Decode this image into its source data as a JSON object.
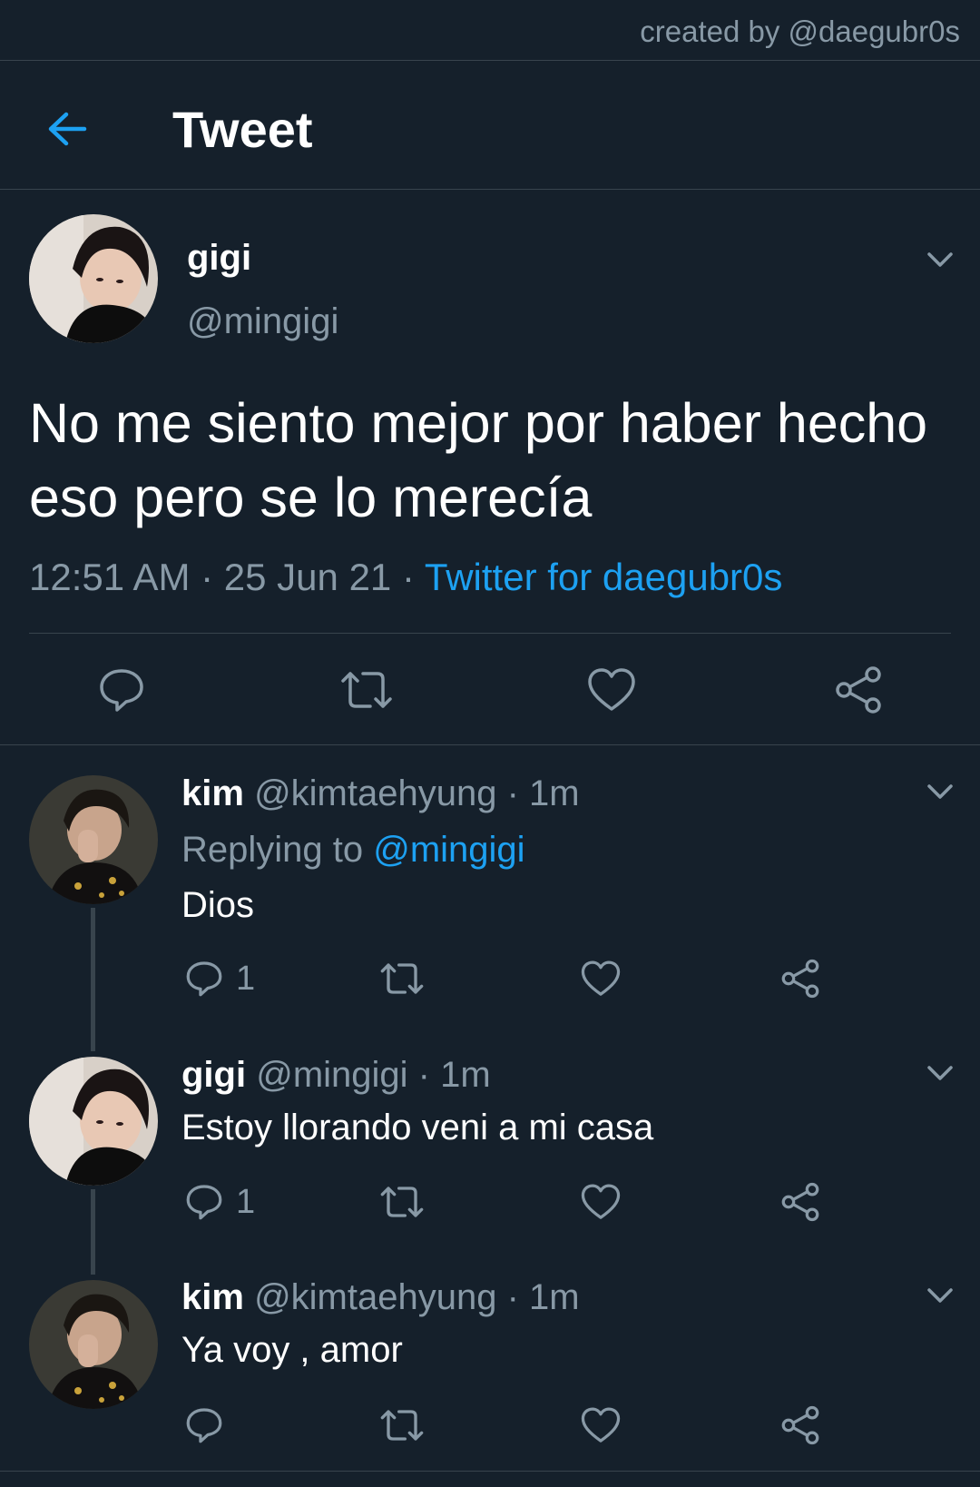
{
  "watermark": "created by @daegubr0s",
  "header": {
    "title": "Tweet",
    "back_icon": "arrow-left-icon"
  },
  "colors": {
    "background": "#15202b",
    "accent": "#1da1f2",
    "muted": "#8899a6",
    "divider": "#38444d"
  },
  "main_tweet": {
    "name": "gigi",
    "handle": "@mingigi",
    "text": "No me siento mejor por haber hecho eso pero se lo merecía",
    "time": "12:51 AM",
    "date": "25 Jun 21",
    "source": "Twitter for daegubr0s",
    "separator": " · "
  },
  "replies": [
    {
      "name": "kim",
      "handle": "@kimtaehyung",
      "time": "1m",
      "replying_label": "Replying to ",
      "replying_handle": "@mingigi",
      "text": "Dios",
      "reply_count": "1"
    },
    {
      "name": "gigi",
      "handle": "@mingigi",
      "time": "1m",
      "text": "Estoy llorando veni a mi casa",
      "reply_count": "1"
    },
    {
      "name": "kim",
      "handle": "@kimtaehyung",
      "time": "1m",
      "text": "Ya voy , amor",
      "reply_count": ""
    }
  ],
  "dot": " · "
}
